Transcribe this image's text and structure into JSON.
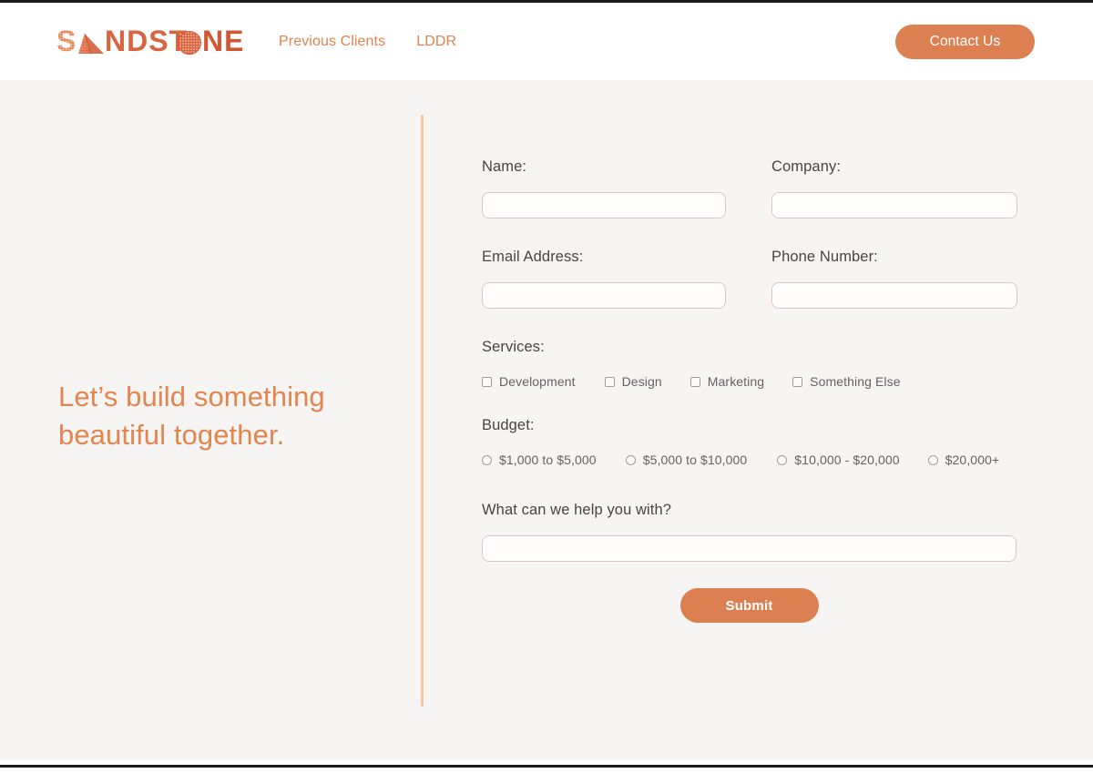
{
  "brand": {
    "name": "SANDSTONE",
    "letters_before_pyramid": "S",
    "letters_mid": "NDST",
    "letters_after_sphere": "NE",
    "accent_color": "#dd8051",
    "logo_dark": "#c9492f"
  },
  "header": {
    "nav": [
      {
        "label": "Previous Clients",
        "name": "nav-previous-clients"
      },
      {
        "label": "LDDR",
        "name": "nav-lddr"
      }
    ],
    "cta_label": "Contact Us"
  },
  "hero": {
    "headline": "Let’s build something beautiful together."
  },
  "form": {
    "fields": {
      "name": {
        "label": "Name:",
        "value": "",
        "placeholder": ""
      },
      "company": {
        "label": "Company:",
        "value": "",
        "placeholder": ""
      },
      "email": {
        "label": "Email Address:",
        "value": "",
        "placeholder": ""
      },
      "phone": {
        "label": "Phone Number:",
        "value": "",
        "placeholder": ""
      },
      "message": {
        "label": "What can we help you with?",
        "value": "",
        "placeholder": ""
      }
    },
    "services": {
      "label": "Services:",
      "options": [
        {
          "label": "Development",
          "checked": false
        },
        {
          "label": "Design",
          "checked": false
        },
        {
          "label": "Marketing",
          "checked": false
        },
        {
          "label": "Something Else",
          "checked": false
        }
      ]
    },
    "budget": {
      "label": "Budget:",
      "options": [
        {
          "label": "$1,000 to $5,000",
          "checked": false
        },
        {
          "label": "$5,000 to $10,000",
          "checked": false
        },
        {
          "label": "$10,000 - $20,000",
          "checked": false
        },
        {
          "label": "$20,000+",
          "checked": false
        }
      ]
    },
    "submit_label": "Submit"
  },
  "theme": {
    "page_background": "#f6f5f3",
    "header_background": "#ffffff",
    "accent": "#dd8051",
    "headline_color": "#e3854f",
    "divider_color": "#f6c6a1",
    "input_border": "#d8c9c4",
    "label_color": "#4a4443"
  }
}
